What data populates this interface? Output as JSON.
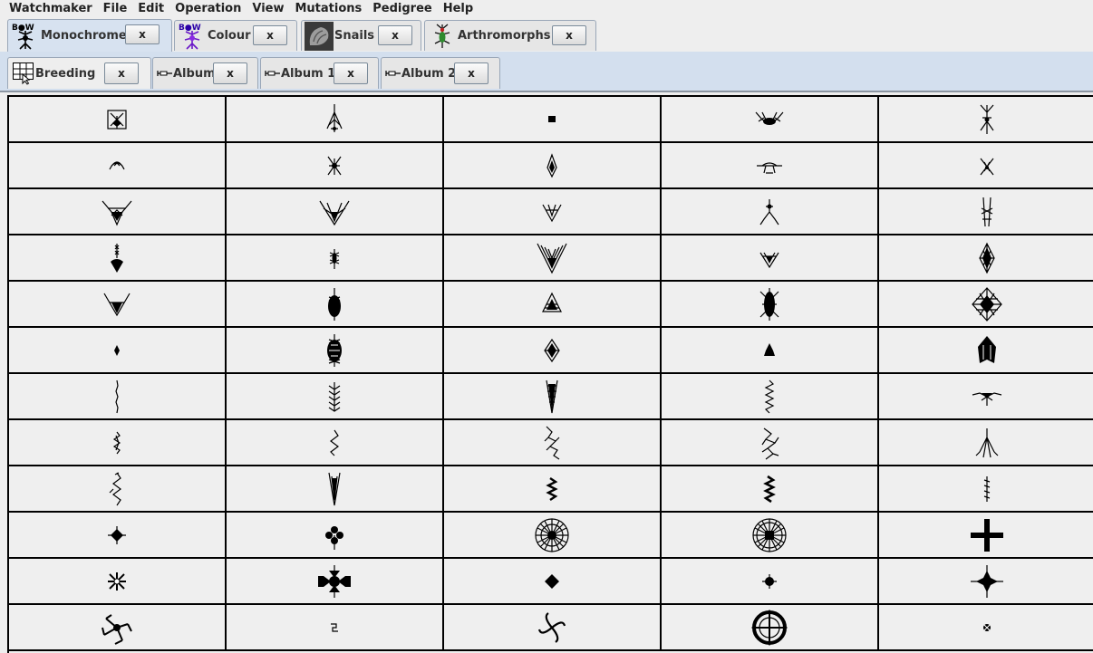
{
  "menu": [
    "Watchmaker",
    "File",
    "Edit",
    "Operation",
    "View",
    "Mutations",
    "Pedigree",
    "Help"
  ],
  "top_tabs": [
    {
      "label": "Monochrome",
      "close": "x",
      "icon": "biomorph-monochrome-icon",
      "active": true
    },
    {
      "label": "Colour",
      "close": "x",
      "icon": "biomorph-colour-icon",
      "active": false
    },
    {
      "label": "Snails",
      "close": "x",
      "icon": "snail-shell-icon",
      "active": false
    },
    {
      "label": "Arthromorphs",
      "close": "x",
      "icon": "arthromorph-insect-icon",
      "active": false
    }
  ],
  "icon_text": {
    "bw": "B●W"
  },
  "sub_tabs": [
    {
      "label": "Breeding",
      "close": "x",
      "icon": "breeding-grid-icon",
      "active": true
    },
    {
      "label": "Album",
      "close": "x",
      "icon": "album-pin-icon",
      "active": false
    },
    {
      "label": "Album 1",
      "close": "x",
      "icon": "album-pin-icon",
      "active": false
    },
    {
      "label": "Album 2",
      "close": "x",
      "icon": "album-pin-icon",
      "active": false
    }
  ],
  "grid": {
    "rows": 12,
    "columns": 5
  }
}
